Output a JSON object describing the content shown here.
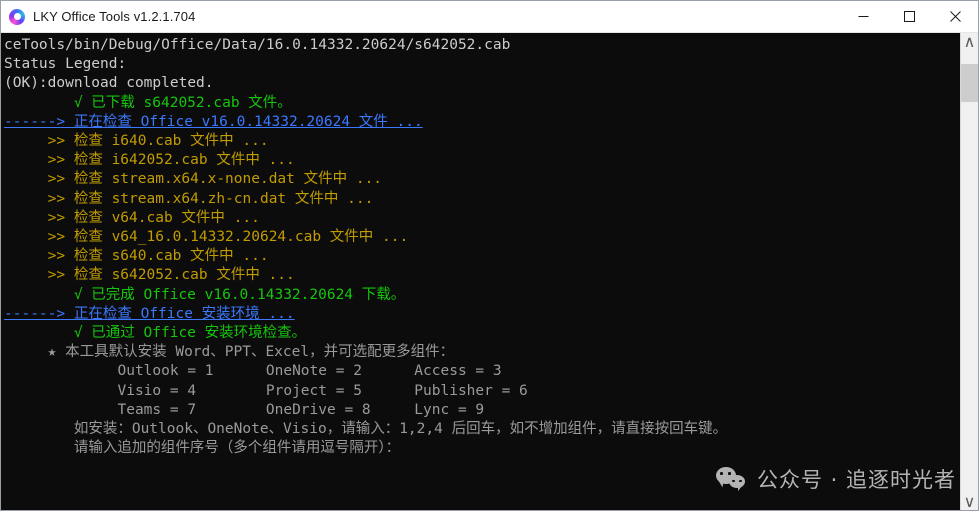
{
  "window": {
    "title": "LKY Office Tools v1.2.1.704",
    "icon": "app-logo-icon",
    "controls": {
      "minimize": "minimize-icon",
      "maximize": "maximize-icon",
      "close": "close-icon"
    }
  },
  "scrollbar": {
    "up_arrow": "∧",
    "down_arrow": "∨"
  },
  "console": {
    "lines": [
      {
        "text": "ceTools/bin/Debug/Office/Data/16.0.14332.20624/s642052.cab",
        "color": "white"
      },
      {
        "text": "",
        "color": "white"
      },
      {
        "text": "Status Legend:",
        "color": "white"
      },
      {
        "text": "(OK):download completed.",
        "color": "white"
      },
      {
        "text": "        √ 已下载 s642052.cab 文件。",
        "color": "green"
      },
      {
        "text": "",
        "color": "white"
      },
      {
        "text": "------> 正在检查 Office v16.0.14332.20624 文件 ...",
        "color": "blue",
        "underline": true
      },
      {
        "text": "     >> 检查 i640.cab 文件中 ...",
        "color": "yellow"
      },
      {
        "text": "     >> 检查 i642052.cab 文件中 ...",
        "color": "yellow"
      },
      {
        "text": "     >> 检查 stream.x64.x-none.dat 文件中 ...",
        "color": "yellow"
      },
      {
        "text": "     >> 检查 stream.x64.zh-cn.dat 文件中 ...",
        "color": "yellow"
      },
      {
        "text": "     >> 检查 v64.cab 文件中 ...",
        "color": "yellow"
      },
      {
        "text": "     >> 检查 v64_16.0.14332.20624.cab 文件中 ...",
        "color": "yellow"
      },
      {
        "text": "     >> 检查 s640.cab 文件中 ...",
        "color": "yellow"
      },
      {
        "text": "     >> 检查 s642052.cab 文件中 ...",
        "color": "yellow"
      },
      {
        "text": "        √ 已完成 Office v16.0.14332.20624 下载。",
        "color": "green"
      },
      {
        "text": "",
        "color": "white"
      },
      {
        "text": "------> 正在检查 Office 安装环境 ...",
        "color": "blue",
        "underline": true
      },
      {
        "text": "        √ 已通过 Office 安装环境检查。",
        "color": "green"
      },
      {
        "text": "",
        "color": "white"
      },
      {
        "text": "     ★ 本工具默认安装 Word、PPT、Excel，并可选配更多组件：",
        "color": "gray"
      },
      {
        "text": "             Outlook = 1      OneNote = 2      Access = 3",
        "color": "gray"
      },
      {
        "text": "             Visio = 4        Project = 5      Publisher = 6",
        "color": "gray"
      },
      {
        "text": "             Teams = 7        OneDrive = 8     Lync = 9",
        "color": "gray"
      },
      {
        "text": "        如安装：Outlook、OneNote、Visio，请输入：1,2,4 后回车，如不增加组件，请直接按回车键。",
        "color": "gray"
      },
      {
        "text": "",
        "color": "white"
      },
      {
        "text": "        请输入追加的组件序号（多个组件请用逗号隔开）：",
        "color": "gray"
      }
    ]
  },
  "watermark": {
    "text": "公众号 · 追逐时光者",
    "logo": "wechat-icon"
  },
  "colors": {
    "background": "#0c0c0c",
    "white": "#cccccc",
    "green": "#16c60c",
    "blue": "#3b78ff",
    "yellow": "#c19c00",
    "gray": "#9a9a9a"
  }
}
